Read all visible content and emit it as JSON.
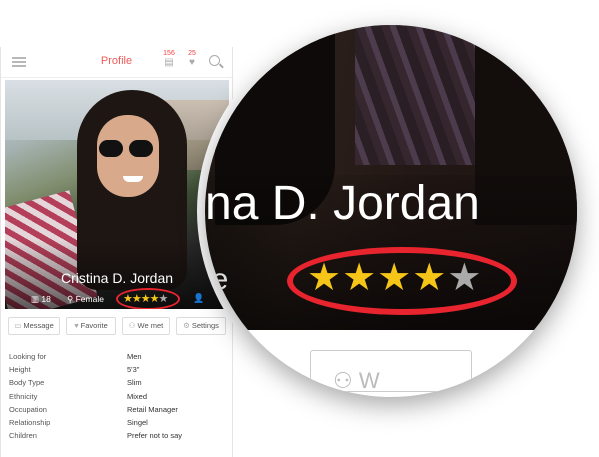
{
  "header": {
    "title": "Profile",
    "messages_count": "156",
    "likes_count": "25"
  },
  "profile": {
    "name": "Cristina D. Jordan",
    "age": "18",
    "gender": "Female",
    "rating": 4,
    "rating_max": 5
  },
  "actions": [
    {
      "label": "Message",
      "icon": "message-icon"
    },
    {
      "label": "Favorite",
      "icon": "heart-icon"
    },
    {
      "label": "We met",
      "icon": "people-icon"
    },
    {
      "label": "Settings",
      "icon": "gear-icon"
    }
  ],
  "details": [
    {
      "label": "Looking for",
      "value": "Men"
    },
    {
      "label": "Height",
      "value": "5'3\""
    },
    {
      "label": "Body Type",
      "value": "Slim"
    },
    {
      "label": "Ethnicity",
      "value": "Mixed"
    },
    {
      "label": "Occupation",
      "value": "Retail Manager"
    },
    {
      "label": "Relationship",
      "value": "Singel"
    },
    {
      "label": "Children",
      "value": "Prefer not to say"
    }
  ],
  "zoom": {
    "name_fragment": "na D. Jordan",
    "gender_fragment": "le",
    "button_fragment": "W"
  },
  "colors": {
    "accent": "#f05a5a",
    "highlight_ring": "#e8242e",
    "star": "#f5c518"
  }
}
